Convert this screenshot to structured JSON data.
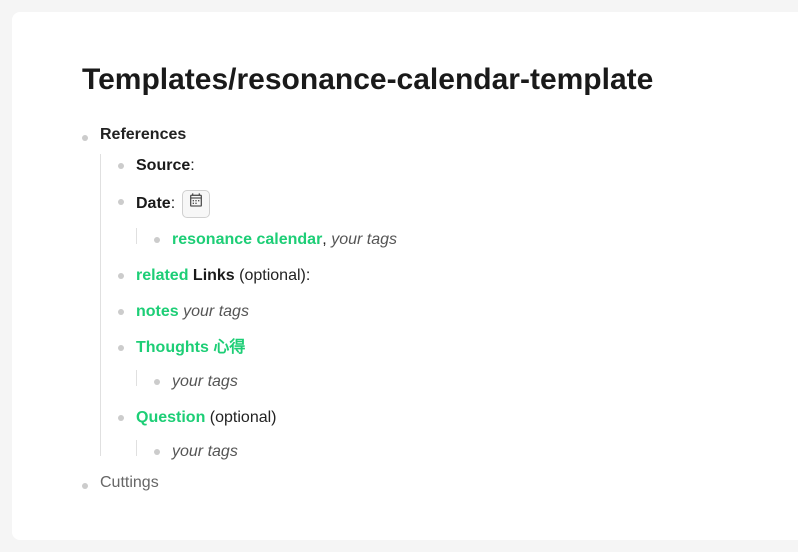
{
  "title": "Templates/resonance-calendar-template",
  "references": {
    "heading": "References",
    "source_label": "Source",
    "source_colon": ":",
    "date_label": "Date",
    "date_colon": ": ",
    "resonance_calendar": "resonance calendar",
    "resonance_sep": ", ",
    "your_tags": "your tags",
    "related": "related",
    "related_links": " Links ",
    "optional": "(optional):",
    "notes": "notes",
    "notes_sep": " ",
    "thoughts": "Thoughts 心得",
    "question": "Question",
    "question_opt_sep": " ",
    "question_optional": "(optional)"
  },
  "cuttings": "Cuttings"
}
